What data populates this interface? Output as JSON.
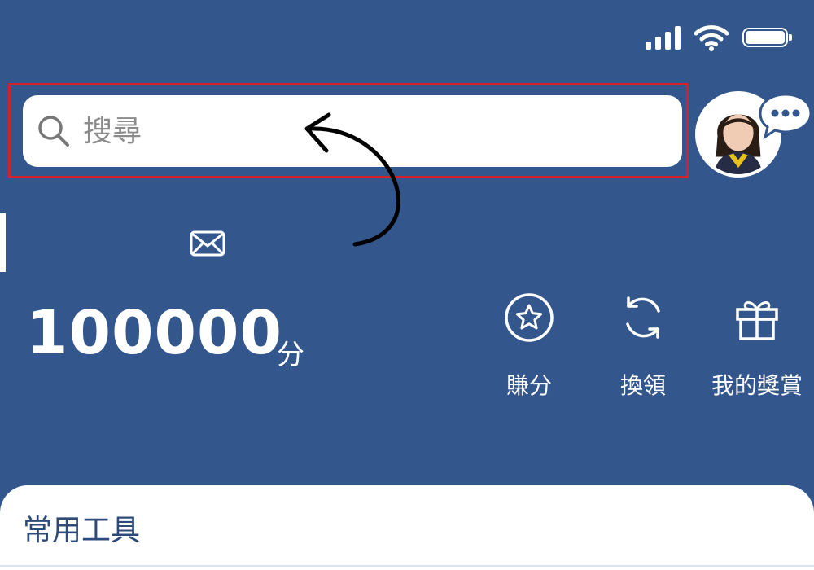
{
  "status_bar": {
    "icons": [
      "signal-icon",
      "wifi-icon",
      "battery-icon"
    ]
  },
  "search": {
    "placeholder": "搜尋",
    "value": ""
  },
  "points": {
    "value": "100000",
    "unit": "分"
  },
  "actions": [
    {
      "label": "賺分",
      "icon": "star-circle-icon"
    },
    {
      "label": "換領",
      "icon": "refresh-icon"
    },
    {
      "label": "我的獎賞",
      "icon": "gift-icon"
    }
  ],
  "tools": {
    "title": "常用工具"
  },
  "colors": {
    "background": "#33568d",
    "highlight": "#d61f26",
    "card": "#ffffff"
  }
}
